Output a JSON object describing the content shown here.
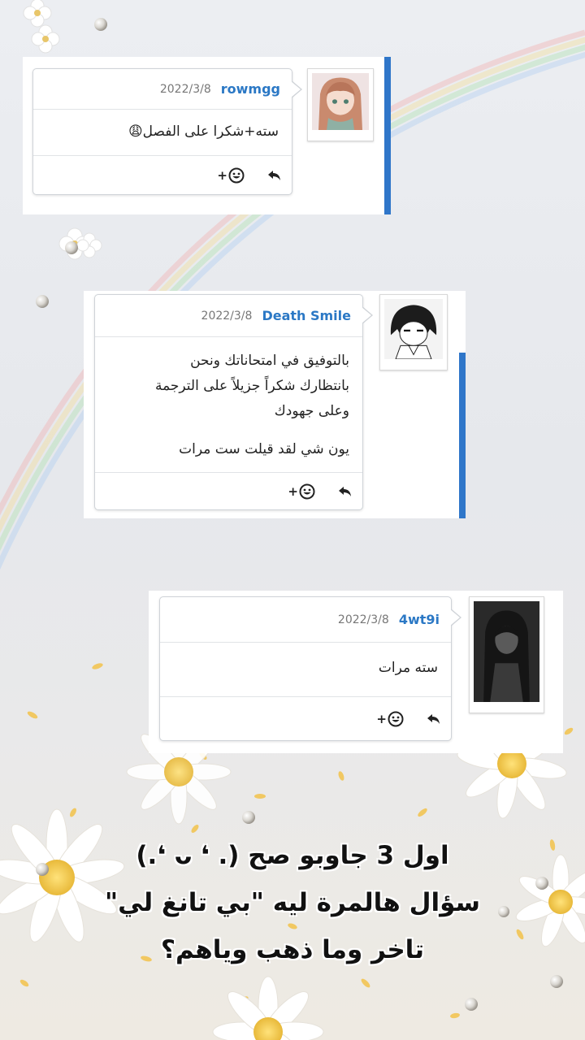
{
  "comments": [
    {
      "user": "rowmgg",
      "date": "2022/3/8",
      "lines": [
        "سته+شكرا على الفصل😩"
      ],
      "react_plus": "+"
    },
    {
      "user": "Death Smile",
      "date": "2022/3/8",
      "lines": [
        "بالتوفيق في امتحاناتك ونحن",
        "بانتظارك شكراً جزيلاً على الترجمة",
        "وعلى جهودك",
        "يون شي لقد قيلت ست مرات"
      ],
      "react_plus": "+"
    },
    {
      "user": "4wt9i",
      "date": "2022/3/8",
      "lines": [
        "سته مرات"
      ],
      "react_plus": "+"
    }
  ],
  "caption": {
    "line1": "اول 3 جاوبو صح (. ❛ ᴗ ❛.)",
    "line2": "سؤال هالمرة ليه \"بي تانغ لي\"",
    "line3": "تاخر وما ذهب وياهم؟"
  },
  "colors": {
    "accent": "#2f76c9",
    "username": "#2b78c5"
  },
  "icons": [
    "reply-icon",
    "add-reaction-icon"
  ]
}
